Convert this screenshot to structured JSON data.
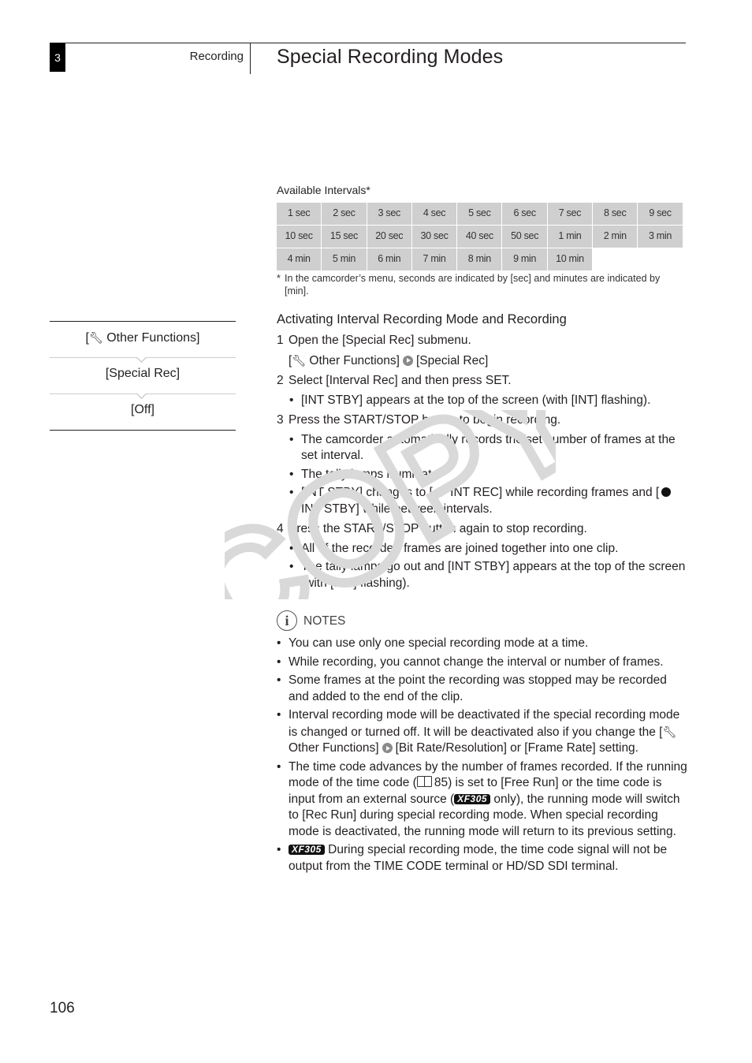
{
  "header": {
    "chapter_number": "3",
    "chapter_name": "Recording",
    "page_title": "Special Recording Modes"
  },
  "intervals": {
    "label": "Available Intervals*",
    "cells": [
      "1 sec",
      "2 sec",
      "3 sec",
      "4 sec",
      "5 sec",
      "6 sec",
      "7 sec",
      "8 sec",
      "9 sec",
      "10 sec",
      "15 sec",
      "20 sec",
      "30 sec",
      "40 sec",
      "50 sec",
      "1 min",
      "2 min",
      "3 min",
      "4 min",
      "5 min",
      "6 min",
      "7 min",
      "8 min",
      "9 min",
      "10 min"
    ],
    "footnote_marker": "*",
    "footnote": "In the camcorder’s menu, seconds are indicated by [sec] and minutes are indicated by [min]."
  },
  "menu_path": {
    "items": [
      "[⚑ Other Functions]",
      "[Special Rec]",
      "[Off]"
    ],
    "item1_prefix": "[",
    "item1_text": " Other Functions]",
    "wrench_icon": "wrench-icon"
  },
  "section": {
    "heading": "Activating Interval Recording Mode and Recording",
    "steps": [
      {
        "num": "1",
        "text": "Open the [Special Rec] submenu.",
        "path_prefix": "[",
        "path_mid": " Other Functions]",
        "path_end": "[Special Rec]"
      },
      {
        "num": "2",
        "text": "Select [Interval Rec] and then press SET.",
        "bullets": [
          "[INT STBY] appears at the top of the screen (with [INT] flashing)."
        ]
      },
      {
        "num": "3",
        "text": "Press the START/STOP button to begin recording.",
        "bullets": [
          "The camcorder automatically records the set number of frames at the set interval.",
          "The tally lamps illuminate."
        ],
        "bullet3_a": "[INT STBY] changes to [",
        "bullet3_b": " INT REC] while recording frames and [",
        "bullet3_c": " INT STBY] while between intervals."
      },
      {
        "num": "4",
        "text": "Press the START/STOP button again to stop recording.",
        "bullets": [
          "All of the recorded frames are joined together into one clip.",
          "The tally lamps go out and [INT STBY] appears at the top of the screen (with [INT] flashing)."
        ]
      }
    ]
  },
  "notes": {
    "label": "NOTES",
    "icon": "i",
    "bullet": "•",
    "items": [
      "You can use only one special recording mode at a time.",
      "While recording, you cannot change the interval or number of frames.",
      "Some frames at the point the recording was stopped may be recorded and added to the end of the clip."
    ],
    "note4_a": "Interval recording mode will be deactivated if the special recording mode is changed or turned off. It will be deactivated also if you change the [",
    "note4_b": " Other Functions]",
    "note4_c": "[Bit Rate/Resolution] or [Frame Rate] setting.",
    "note5_a": "The time code advances by the number of frames recorded. If the running mode of the time code (",
    "note5_ref": "85",
    "note5_b": ") is set to [Free Run] or the time code is input from an external source (",
    "note5_c": " only), the running mode will switch to [Rec Run] during special recording mode. When special recording mode is deactivated, the running mode will return to its previous setting.",
    "model_badge": "XF305",
    "note6": " During special recording mode, the time code signal will not be output from the TIME CODE terminal or HD/SD SDI terminal."
  },
  "watermark": "COPY",
  "page_number": "106"
}
